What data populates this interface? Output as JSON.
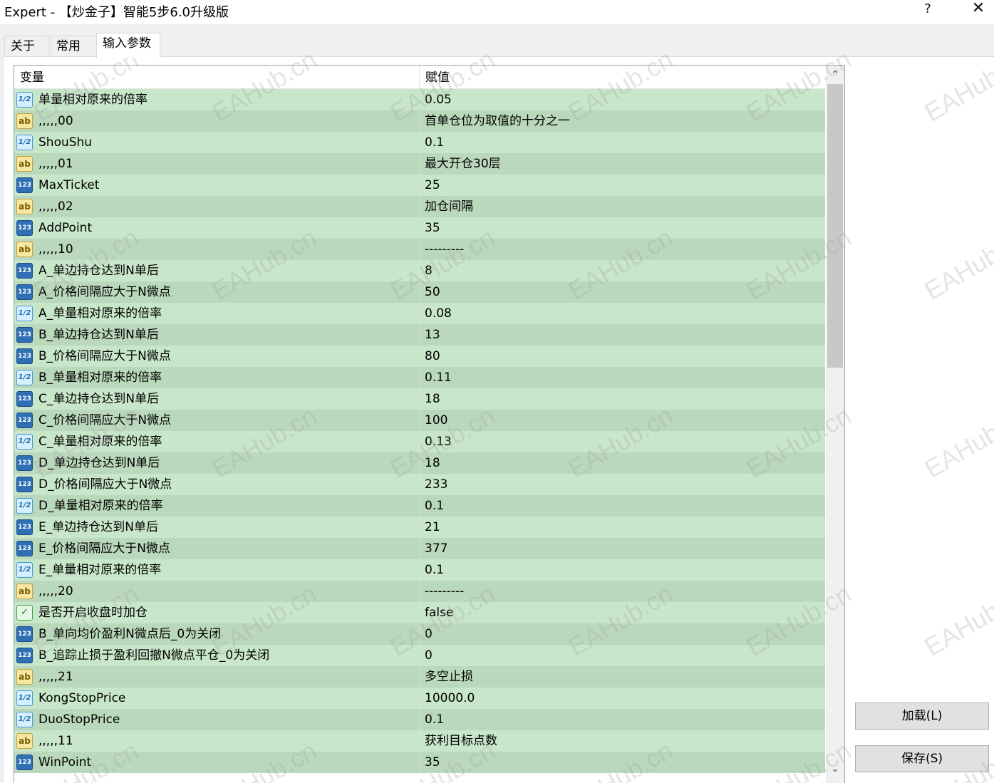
{
  "window": {
    "title": "Expert - 【炒金子】智能5步6.0升级版",
    "help_glyph": "?",
    "close_glyph": "✕"
  },
  "tabs": [
    {
      "label": "关于",
      "active": false
    },
    {
      "label": "常用",
      "active": false
    },
    {
      "label": "输入参数",
      "active": true
    }
  ],
  "grid": {
    "columns": {
      "name": "变量",
      "value": "赋值"
    },
    "rows": [
      {
        "type": "double",
        "icon": "1/2",
        "name": "单量相对原来的倍率",
        "value": "0.05"
      },
      {
        "type": "string",
        "icon": "ab",
        "name": ",,,,,00",
        "value": "首单仓位为取值的十分之一"
      },
      {
        "type": "double",
        "icon": "1/2",
        "name": "ShouShu",
        "value": "0.1"
      },
      {
        "type": "string",
        "icon": "ab",
        "name": ",,,,,01",
        "value": "最大开仓30层"
      },
      {
        "type": "int",
        "icon": "123",
        "name": "MaxTicket",
        "value": "25"
      },
      {
        "type": "string",
        "icon": "ab",
        "name": ",,,,,02",
        "value": "加仓间隔"
      },
      {
        "type": "int",
        "icon": "123",
        "name": "AddPoint",
        "value": "35"
      },
      {
        "type": "string",
        "icon": "ab",
        "name": ",,,,,10",
        "value": "---------"
      },
      {
        "type": "int",
        "icon": "123",
        "name": "A_单边持仓达到N单后",
        "value": "8"
      },
      {
        "type": "int",
        "icon": "123",
        "name": "A_价格间隔应大于N微点",
        "value": "50"
      },
      {
        "type": "double",
        "icon": "1/2",
        "name": "A_单量相对原来的倍率",
        "value": "0.08"
      },
      {
        "type": "int",
        "icon": "123",
        "name": "B_单边持仓达到N单后",
        "value": "13"
      },
      {
        "type": "int",
        "icon": "123",
        "name": "B_价格间隔应大于N微点",
        "value": "80"
      },
      {
        "type": "double",
        "icon": "1/2",
        "name": "B_单量相对原来的倍率",
        "value": "0.11"
      },
      {
        "type": "int",
        "icon": "123",
        "name": "C_单边持仓达到N单后",
        "value": "18"
      },
      {
        "type": "int",
        "icon": "123",
        "name": "C_价格间隔应大于N微点",
        "value": "100"
      },
      {
        "type": "double",
        "icon": "1/2",
        "name": "C_单量相对原来的倍率",
        "value": "0.13"
      },
      {
        "type": "int",
        "icon": "123",
        "name": "D_单边持仓达到N单后",
        "value": "18"
      },
      {
        "type": "int",
        "icon": "123",
        "name": "D_价格间隔应大于N微点",
        "value": "233"
      },
      {
        "type": "double",
        "icon": "1/2",
        "name": "D_单量相对原来的倍率",
        "value": "0.1"
      },
      {
        "type": "int",
        "icon": "123",
        "name": "E_单边持仓达到N单后",
        "value": "21"
      },
      {
        "type": "int",
        "icon": "123",
        "name": "E_价格间隔应大于N微点",
        "value": "377"
      },
      {
        "type": "double",
        "icon": "1/2",
        "name": "E_单量相对原来的倍率",
        "value": "0.1"
      },
      {
        "type": "string",
        "icon": "ab",
        "name": ",,,,,20",
        "value": "---------"
      },
      {
        "type": "bool",
        "icon": "✓",
        "name": "是否开启收盘时加仓",
        "value": "false"
      },
      {
        "type": "int",
        "icon": "123",
        "name": "B_单向均价盈利N微点后_0为关闭",
        "value": "0"
      },
      {
        "type": "int",
        "icon": "123",
        "name": "B_追踪止损于盈利回撤N微点平仓_0为关闭",
        "value": "0"
      },
      {
        "type": "string",
        "icon": "ab",
        "name": ",,,,,21",
        "value": "多空止损"
      },
      {
        "type": "double",
        "icon": "1/2",
        "name": "KongStopPrice",
        "value": "10000.0"
      },
      {
        "type": "double",
        "icon": "1/2",
        "name": "DuoStopPrice",
        "value": "0.1"
      },
      {
        "type": "string",
        "icon": "ab",
        "name": ",,,,,11",
        "value": "获利目标点数"
      },
      {
        "type": "int",
        "icon": "123",
        "name": "WinPoint",
        "value": "35"
      }
    ]
  },
  "scrollbar": {
    "up_glyph": "⌃",
    "down_glyph": "⌄",
    "position_fraction": 0.0,
    "visible_fraction": 0.42
  },
  "buttons": {
    "load_label": "加载(L)",
    "save_label": "保存(S)"
  },
  "watermark_text": "EAHub.cn",
  "colors": {
    "row_odd": "#c8e6c9",
    "row_even": "#bad8bb",
    "client_bg": "#f0f0f0"
  }
}
